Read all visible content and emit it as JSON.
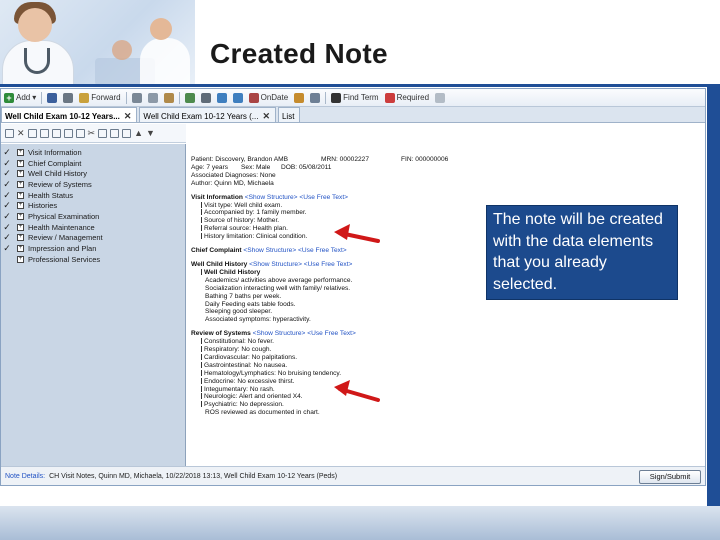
{
  "slide": {
    "title": "Created Note",
    "callout_text": "The note will be created with the data elements that you already selected."
  },
  "toolbar": {
    "items": [
      "Add",
      "Forward",
      "OnDate",
      "Find Term",
      "Required"
    ]
  },
  "tabs": [
    {
      "label": "Well Child Exam 10-12 Years..."
    },
    {
      "label": "Well Child Exam 10-12 Years (..."
    },
    {
      "label": "List"
    }
  ],
  "left_panel": {
    "sections": [
      "Visit Information",
      "Chief Complaint",
      "Well Child History",
      "Review of Systems",
      "Health Status",
      "Histories",
      "Physical Examination",
      "Health Maintenance",
      "Review / Management",
      "Impression and Plan",
      "Professional Services"
    ]
  },
  "note": {
    "patient_label": "Patient:",
    "patient_name": "Discovery, Brandon AMB",
    "mrn": "MRN: 00002227",
    "fin": "FIN: 000000006",
    "age": "Age:  7 years",
    "sex": "Sex: Male",
    "dob": "DOB: 05/08/2011",
    "associated_diagnoses": "Associated Diagnoses:   None",
    "author": "Author:   Quinn MD, Michaela",
    "show_structure": "<Show Structure>",
    "use_free_text": "<Use Free Text>",
    "visit_info": {
      "heading": "Visit Information",
      "lines": [
        "Visit type:  Well child exam.",
        "Accompanied by:  1 family member.",
        "Source of history:  Mother.",
        "Referral source:  Health plan.",
        "History limitation:  Clinical condition."
      ]
    },
    "chief_complaint": {
      "heading": "Chief Complaint"
    },
    "well_child_history": {
      "heading": "Well Child History",
      "sub": "Well Child History",
      "lines": [
        "Academics/ activities above average performance.",
        "Socialization interacting well with family/ relatives.",
        "Bathing 7 baths per week.",
        "Daily Feeding eats table foods.",
        "Sleeping good sleeper.",
        "Associated symptoms: hyperactivity."
      ]
    },
    "review_of_systems": {
      "heading": "Review of Systems",
      "lines": [
        "Constitutional:  No fever.",
        "Respiratory:  No cough.",
        "Cardiovascular:  No palpitations.",
        "Gastrointestinal:  No nausea.",
        "Hematology/Lymphatics:  No bruising tendency.",
        "Endocrine:  No excessive thirst.",
        "Integumentary:  No rash.",
        "Neurologic:  Alert and oriented X4.",
        "Psychiatric:  No depression."
      ],
      "footer": "ROS reviewed as documented in chart."
    }
  },
  "status_bar": {
    "label": "Note Details:",
    "text": "CH Visit Notes, Quinn MD, Michaela, 10/22/2018 13:13, Well Child Exam 10-12 Years (Peds)",
    "sign_button": "Sign/Submit"
  },
  "colors": {
    "brand_blue": "#1f4e96",
    "callout_bg": "#1c4a8d",
    "arrow_red": "#d01818",
    "link_blue": "#2152c4"
  }
}
